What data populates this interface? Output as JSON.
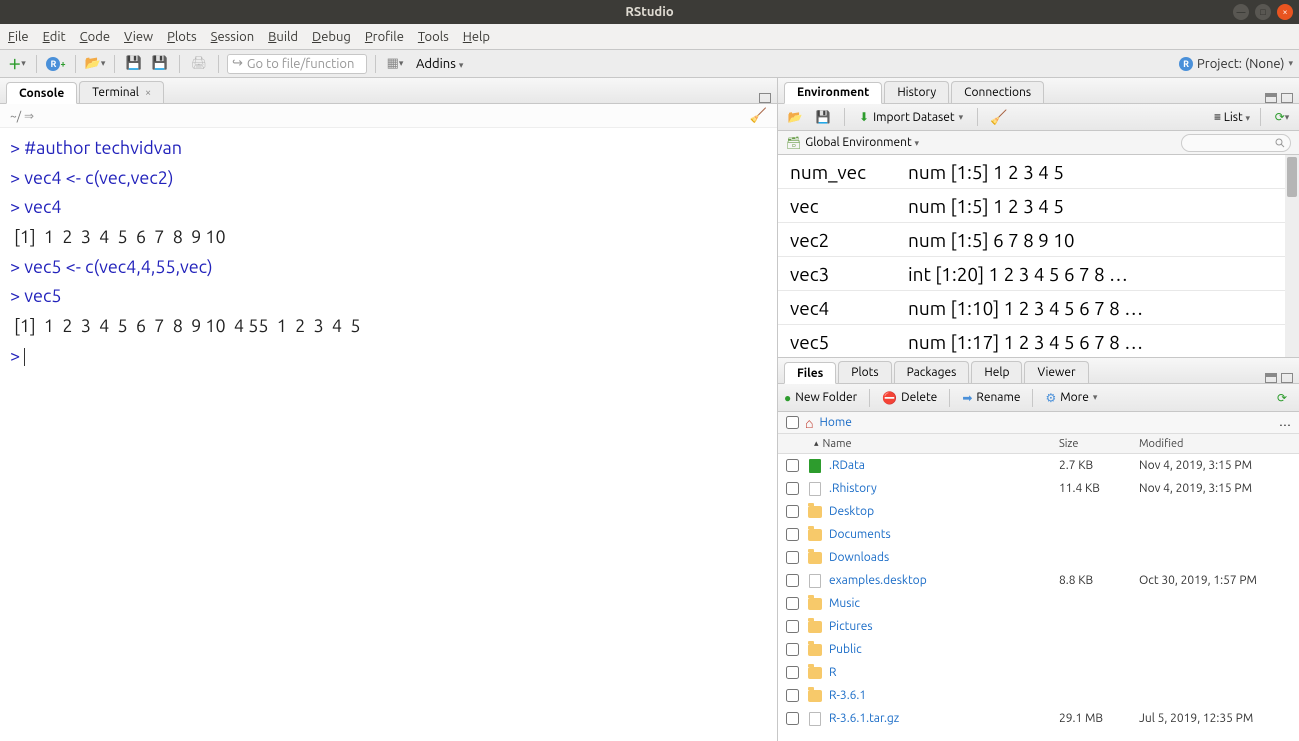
{
  "window_title": "RStudio",
  "menubar": [
    "File",
    "Edit",
    "Code",
    "View",
    "Plots",
    "Session",
    "Build",
    "Debug",
    "Profile",
    "Tools",
    "Help"
  ],
  "toolbar": {
    "search_placeholder": "Go to file/function",
    "addins_label": "Addins",
    "project_label": "Project: (None)"
  },
  "left_pane": {
    "tabs": [
      {
        "label": "Console",
        "active": true,
        "closable": false
      },
      {
        "label": "Terminal",
        "active": false,
        "closable": true
      }
    ],
    "console_path": "~/",
    "console_lines": [
      {
        "type": "code",
        "prompt": ">",
        "text": "#author techvidvan"
      },
      {
        "type": "code",
        "prompt": ">",
        "text": "vec4 <- c(vec,vec2)"
      },
      {
        "type": "code",
        "prompt": ">",
        "text": "vec4"
      },
      {
        "type": "output",
        "text": " [1]  1  2  3  4  5  6  7  8  9 10"
      },
      {
        "type": "code",
        "prompt": ">",
        "text": "vec5 <- c(vec4,4,55,vec)"
      },
      {
        "type": "code",
        "prompt": ">",
        "text": "vec5"
      },
      {
        "type": "output",
        "text": " [1]  1  2  3  4  5  6  7  8  9 10  4 55  1  2  3  4  5"
      },
      {
        "type": "code",
        "prompt": ">",
        "text": ""
      }
    ]
  },
  "env_pane": {
    "tabs": [
      {
        "label": "Environment",
        "active": true
      },
      {
        "label": "History",
        "active": false
      },
      {
        "label": "Connections",
        "active": false
      }
    ],
    "import_label": "Import Dataset",
    "view_mode": "List",
    "scope": "Global Environment",
    "search_placeholder": "",
    "vars": [
      {
        "name": "num_vec",
        "value": "num [1:5] 1 2 3 4 5"
      },
      {
        "name": "vec",
        "value": "num [1:5] 1 2 3 4 5"
      },
      {
        "name": "vec2",
        "value": "num [1:5] 6 7 8 9 10"
      },
      {
        "name": "vec3",
        "value": "int [1:20] 1 2 3 4 5 6 7 8 …"
      },
      {
        "name": "vec4",
        "value": "num [1:10] 1 2 3 4 5 6 7 8 …"
      },
      {
        "name": "vec5",
        "value": "num [1:17] 1 2 3 4 5 6 7 8 …"
      }
    ]
  },
  "files_pane": {
    "tabs": [
      {
        "label": "Files",
        "active": true
      },
      {
        "label": "Plots",
        "active": false
      },
      {
        "label": "Packages",
        "active": false
      },
      {
        "label": "Help",
        "active": false
      },
      {
        "label": "Viewer",
        "active": false
      }
    ],
    "toolbar": {
      "new_folder": "New Folder",
      "delete": "Delete",
      "rename": "Rename",
      "more": "More"
    },
    "breadcrumb": "Home",
    "columns": {
      "name": "Name",
      "size": "Size",
      "modified": "Modified"
    },
    "rows": [
      {
        "icon": "rdata",
        "name": ".RData",
        "size": "2.7 KB",
        "modified": "Nov 4, 2019, 3:15 PM"
      },
      {
        "icon": "doc",
        "name": ".Rhistory",
        "size": "11.4 KB",
        "modified": "Nov 4, 2019, 3:15 PM"
      },
      {
        "icon": "folder",
        "name": "Desktop",
        "size": "",
        "modified": ""
      },
      {
        "icon": "folder",
        "name": "Documents",
        "size": "",
        "modified": ""
      },
      {
        "icon": "folder",
        "name": "Downloads",
        "size": "",
        "modified": ""
      },
      {
        "icon": "doc",
        "name": "examples.desktop",
        "size": "8.8 KB",
        "modified": "Oct 30, 2019, 1:57 PM"
      },
      {
        "icon": "folder",
        "name": "Music",
        "size": "",
        "modified": ""
      },
      {
        "icon": "folder",
        "name": "Pictures",
        "size": "",
        "modified": ""
      },
      {
        "icon": "folder-lock",
        "name": "Public",
        "size": "",
        "modified": ""
      },
      {
        "icon": "folder",
        "name": "R",
        "size": "",
        "modified": ""
      },
      {
        "icon": "folder",
        "name": "R-3.6.1",
        "size": "",
        "modified": ""
      },
      {
        "icon": "doc",
        "name": "R-3.6.1.tar.gz",
        "size": "29.1 MB",
        "modified": "Jul 5, 2019, 12:35 PM"
      }
    ]
  }
}
